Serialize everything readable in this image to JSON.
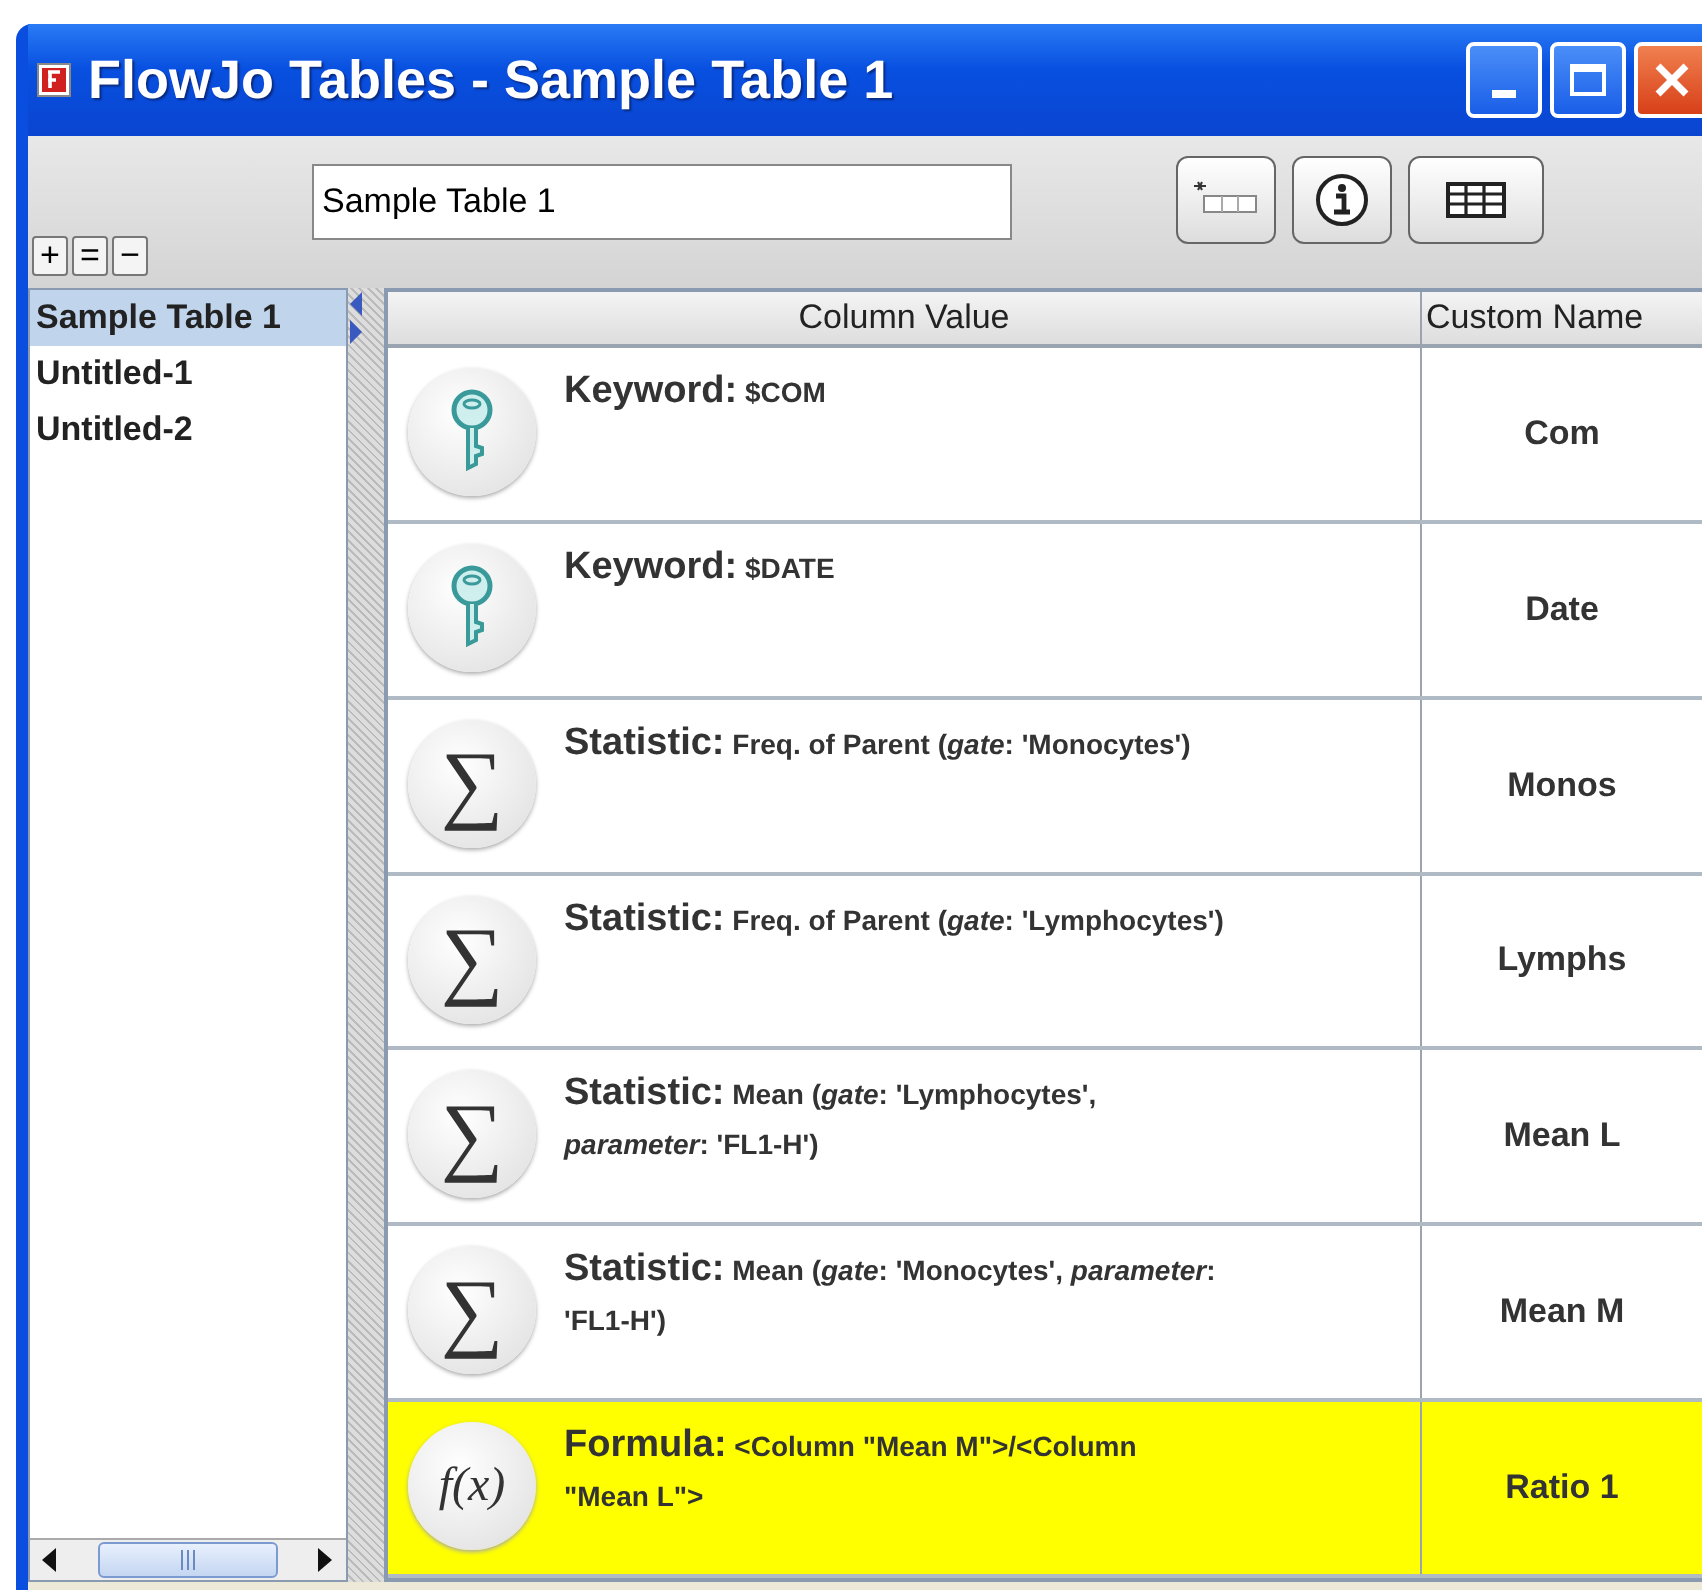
{
  "window": {
    "title": "FlowJo Tables - Sample Table 1"
  },
  "toolbar": {
    "size_buttons": [
      "+",
      "=",
      "−"
    ],
    "table_name": "Sample Table 1"
  },
  "sidebar": {
    "items": [
      {
        "label": "Sample Table 1",
        "selected": true
      },
      {
        "label": "Untitled-1",
        "selected": false
      },
      {
        "label": "Untitled-2",
        "selected": false
      }
    ]
  },
  "table": {
    "columns": [
      "Column Value",
      "Custom Name"
    ],
    "rows": [
      {
        "kind": "keyword",
        "label": "Keyword:",
        "detail": "$COM",
        "custom_name": "Com",
        "selected": false
      },
      {
        "kind": "keyword",
        "label": "Keyword:",
        "detail": "$DATE",
        "custom_name": "Date",
        "selected": false
      },
      {
        "kind": "statistic",
        "icon": "∑",
        "label": "Statistic:",
        "detail": "Freq. of Parent (*gate*: 'Monocytes')",
        "custom_name": "Monos",
        "selected": false
      },
      {
        "kind": "statistic",
        "icon": "∑",
        "label": "Statistic:",
        "detail": "Freq. of Parent (*gate*: 'Lymphocytes')",
        "custom_name": "Lymphs",
        "selected": false
      },
      {
        "kind": "statistic",
        "icon": "∑",
        "label": "Statistic:",
        "detail": "Mean (*gate*: 'Lymphocytes', *parameter*: 'FL1-H')",
        "custom_name": "Mean L",
        "selected": false
      },
      {
        "kind": "statistic",
        "icon": "∑",
        "label": "Statistic:",
        "detail": "Mean (*gate*: 'Monocytes', *parameter*: 'FL1-H')",
        "custom_name": "Mean M",
        "selected": false
      },
      {
        "kind": "formula",
        "icon": "f(x)",
        "label": "Formula:",
        "detail": "<Column \"Mean M\">/<Column \"Mean L\">",
        "custom_name": "Ratio 1",
        "selected": true
      }
    ]
  }
}
